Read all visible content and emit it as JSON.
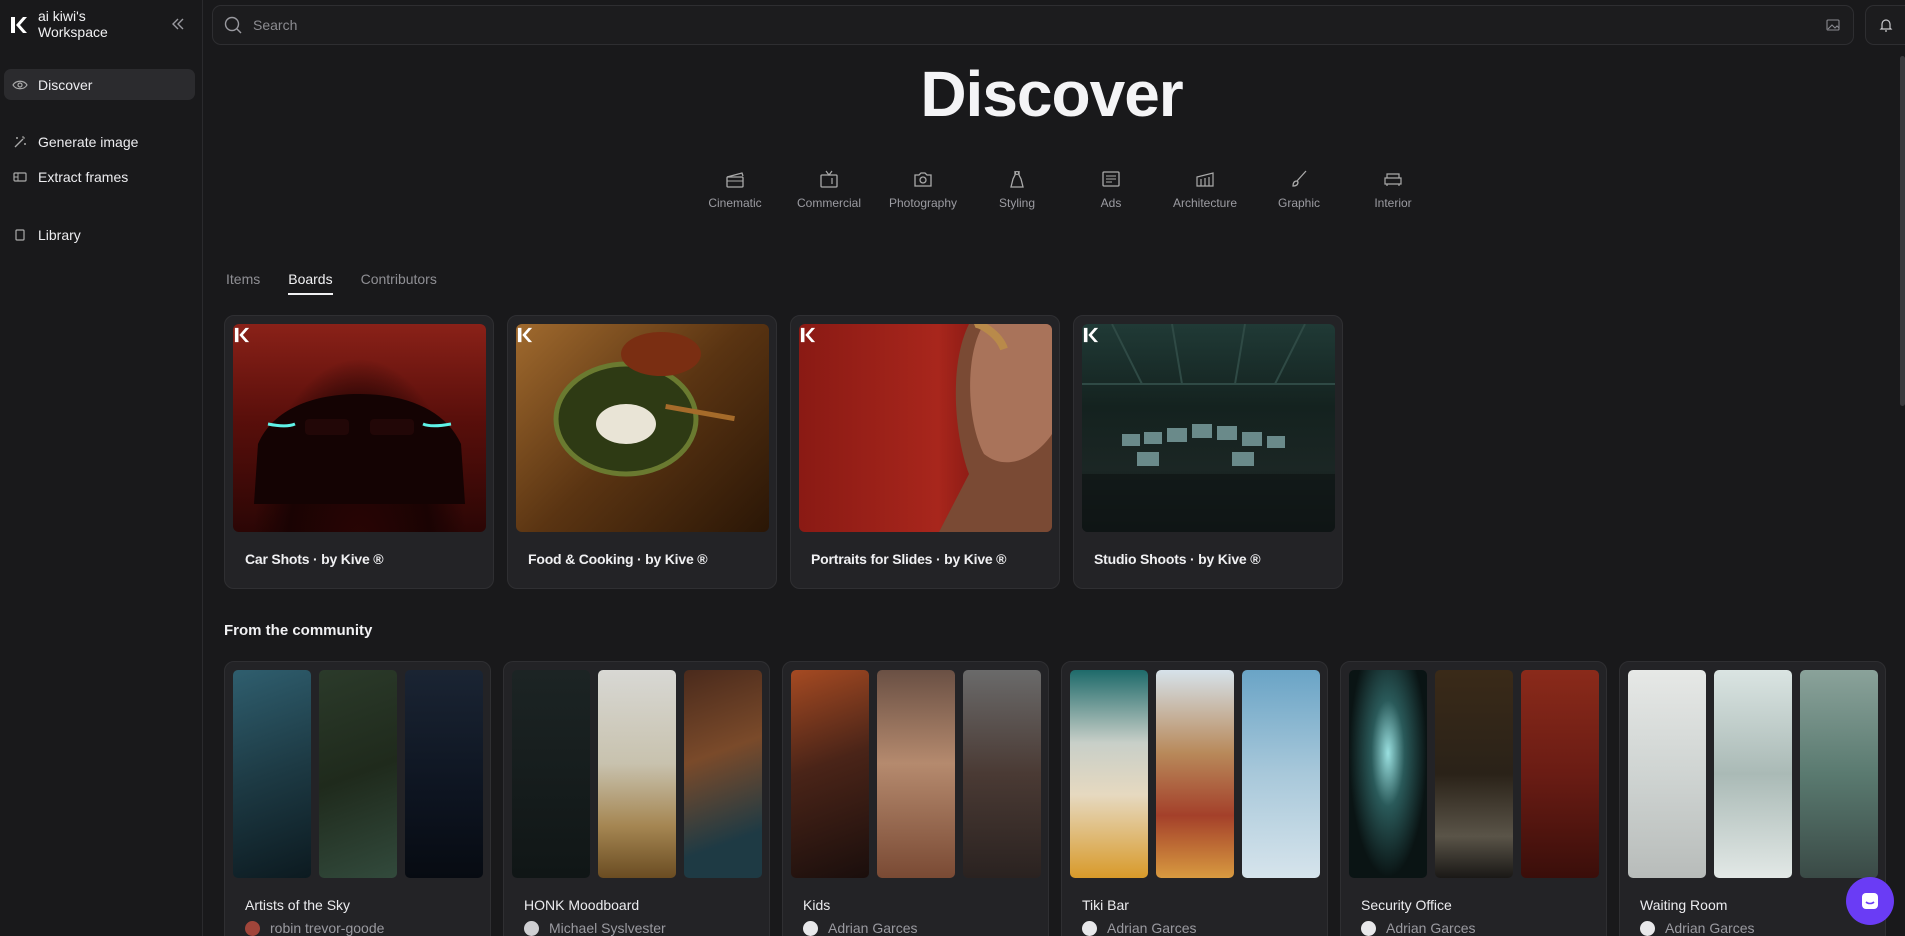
{
  "workspace": {
    "name": "ai kiwi's Workspace"
  },
  "nav": [
    {
      "label": "Discover",
      "icon": "eye-icon",
      "active": true
    },
    {
      "label": "Generate image",
      "icon": "magic-wand-icon"
    },
    {
      "label": "Extract frames",
      "icon": "film-icon"
    },
    {
      "label": "Library",
      "icon": "book-icon"
    }
  ],
  "search": {
    "placeholder": "Search"
  },
  "page": {
    "title": "Discover"
  },
  "categories": [
    {
      "label": "Cinematic",
      "icon": "clapperboard-icon"
    },
    {
      "label": "Commercial",
      "icon": "tv-icon"
    },
    {
      "label": "Photography",
      "icon": "camera-icon"
    },
    {
      "label": "Styling",
      "icon": "dress-icon"
    },
    {
      "label": "Ads",
      "icon": "newspaper-icon"
    },
    {
      "label": "Architecture",
      "icon": "building-icon"
    },
    {
      "label": "Graphic",
      "icon": "brush-icon"
    },
    {
      "label": "Interior",
      "icon": "sofa-icon"
    }
  ],
  "tabs": [
    {
      "label": "Items",
      "active": false
    },
    {
      "label": "Boards",
      "active": true
    },
    {
      "label": "Contributors",
      "active": false
    }
  ],
  "boards": [
    {
      "title": "Car Shots · by Kive ®",
      "theme": "car"
    },
    {
      "title": "Food & Cooking · by Kive ®",
      "theme": "food"
    },
    {
      "title": "Portraits for Slides · by Kive ®",
      "theme": "portrait"
    },
    {
      "title": "Studio Shoots · by Kive ®",
      "theme": "studio"
    }
  ],
  "community": {
    "heading": "From the community",
    "boards": [
      {
        "title": "Artists of the Sky",
        "author": "robin trevor-goode"
      },
      {
        "title": "HONK Moodboard",
        "author": "Michael Syslvester"
      },
      {
        "title": "Kids",
        "author": "Adrian Garces"
      },
      {
        "title": "Tiki Bar",
        "author": "Adrian Garces"
      },
      {
        "title": "Security Office",
        "author": "Adrian Garces"
      },
      {
        "title": "Waiting Room",
        "author": "Adrian Garces"
      }
    ]
  },
  "colors": {
    "accent": "#6a3cf5",
    "background": "#19191b",
    "card": "#232326"
  }
}
